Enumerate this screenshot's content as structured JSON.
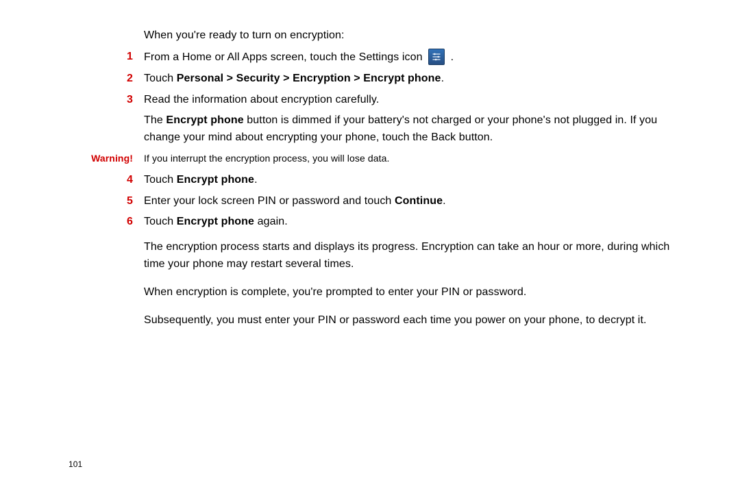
{
  "pageNumber": "101",
  "intro": "When you're ready to turn on encryption:",
  "steps": [
    {
      "num": "1",
      "paragraphs": [
        {
          "runs": [
            {
              "t": "From a Home or All Apps screen, touch the Settings icon "
            },
            {
              "icon": "settings-icon"
            },
            {
              "t": " ."
            }
          ]
        }
      ]
    },
    {
      "num": "2",
      "paragraphs": [
        {
          "runs": [
            {
              "t": "Touch "
            },
            {
              "t": "Personal > Security > Encryption > Encrypt phone",
              "bold": true
            },
            {
              "t": "."
            }
          ]
        }
      ]
    },
    {
      "num": "3",
      "paragraphs": [
        {
          "runs": [
            {
              "t": "Read the information about encryption carefully."
            }
          ]
        },
        {
          "runs": [
            {
              "t": "The "
            },
            {
              "t": "Encrypt phone",
              "bold": true
            },
            {
              "t": " button is dimmed if your battery's not charged or your phone's not plugged in. If you change your mind about encrypting your phone, touch the Back button."
            }
          ]
        }
      ]
    }
  ],
  "warning": {
    "label": "Warning!",
    "text": "If you interrupt the encryption process, you will lose data."
  },
  "steps_after": [
    {
      "num": "4",
      "paragraphs": [
        {
          "runs": [
            {
              "t": "Touch "
            },
            {
              "t": "Encrypt phone",
              "bold": true
            },
            {
              "t": "."
            }
          ]
        }
      ]
    },
    {
      "num": "5",
      "paragraphs": [
        {
          "runs": [
            {
              "t": "Enter your lock screen PIN or password and touch "
            },
            {
              "t": "Continue",
              "bold": true
            },
            {
              "t": "."
            }
          ]
        }
      ]
    },
    {
      "num": "6",
      "paragraphs": [
        {
          "runs": [
            {
              "t": "Touch "
            },
            {
              "t": "Encrypt phone",
              "bold": true
            },
            {
              "t": " again."
            }
          ]
        }
      ]
    }
  ],
  "followups": [
    "The encryption process starts and displays its progress. Encryption can take an hour or more, during which time your phone may restart several times.",
    "When encryption is complete, you're prompted to enter your PIN or password.",
    "Subsequently, you must enter your PIN or password each time you power on your phone, to decrypt it."
  ]
}
